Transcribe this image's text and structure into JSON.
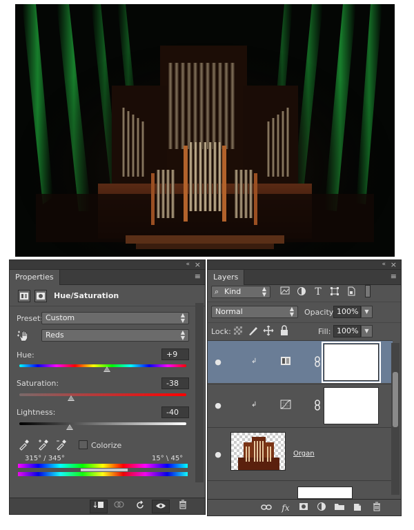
{
  "properties": {
    "tab_label": "Properties",
    "adjustment_title": "Hue/Saturation",
    "preset_label": "Preset:",
    "preset_value": "Custom",
    "channel_value": "Reds",
    "hue_label": "Hue:",
    "hue_value": "+9",
    "hue_level": 0.525,
    "saturation_label": "Saturation:",
    "saturation_value": "-38",
    "saturation_level": 0.31,
    "lightness_label": "Lightness:",
    "lightness_value": "-40",
    "lightness_level": 0.3,
    "colorize_label": "Colorize",
    "range_left": "315° /  345°",
    "range_right": "15° \\ 45°"
  },
  "layers": {
    "tab_label": "Layers",
    "kind_label": "Kind",
    "blend_mode": "Normal",
    "opacity_label": "Opacity:",
    "opacity_value": "100%",
    "lock_label": "Lock:",
    "fill_label": "Fill:",
    "fill_value": "100%",
    "items": [
      {
        "type": "hue-saturation",
        "name": "",
        "selected": true
      },
      {
        "type": "curves",
        "name": "",
        "selected": false
      },
      {
        "type": "image",
        "name": "Organ",
        "selected": false
      }
    ]
  },
  "icons": {
    "collapse": "«",
    "close": "×",
    "panel_menu": "≡",
    "eye": "●"
  },
  "colors": {
    "panel_bg": "#535353",
    "selected_layer": "#6a7d96",
    "curtain_green": "#1fa83a"
  }
}
